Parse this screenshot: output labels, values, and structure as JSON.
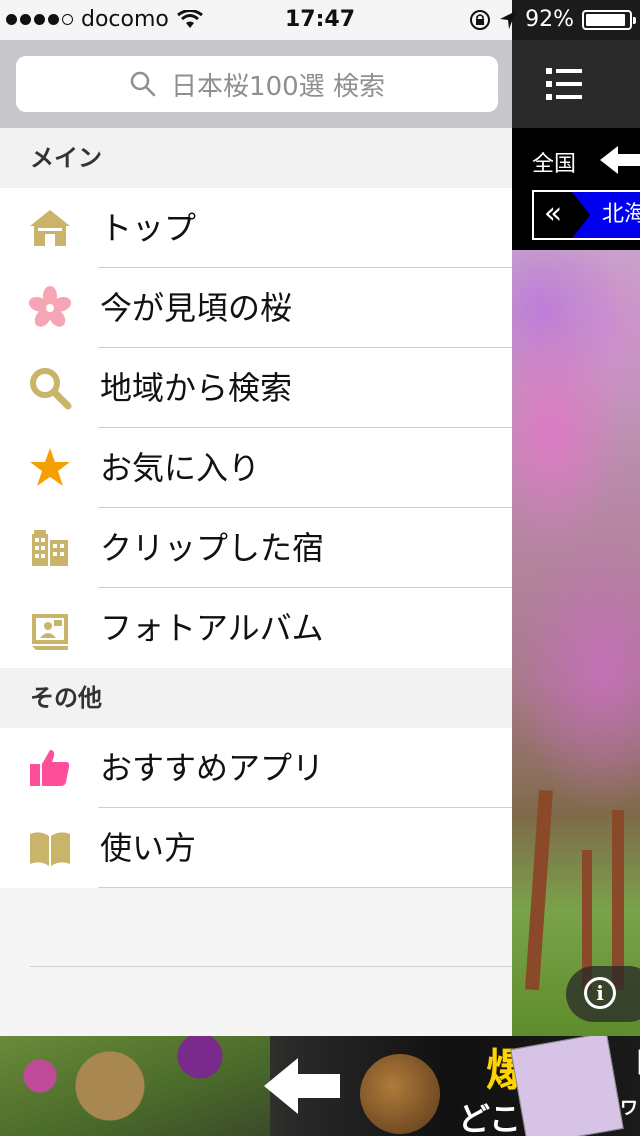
{
  "status_bar": {
    "carrier": "docomo",
    "time": "17:47",
    "battery": "92%",
    "battery_level": 0.92
  },
  "search": {
    "placeholder": "日本桜100選 検索"
  },
  "sections": [
    {
      "title": "メイン",
      "items": [
        {
          "label": "トップ",
          "icon": "home-icon"
        },
        {
          "label": "今が見頃の桜",
          "icon": "sakura-icon"
        },
        {
          "label": "地域から検索",
          "icon": "search-icon"
        },
        {
          "label": "お気に入り",
          "icon": "star-icon"
        },
        {
          "label": "クリップした宿",
          "icon": "hotel-icon"
        },
        {
          "label": "フォトアルバム",
          "icon": "photo-album-icon"
        }
      ]
    },
    {
      "title": "その他",
      "items": [
        {
          "label": "おすすめアプリ",
          "icon": "thumbs-up-icon"
        },
        {
          "label": "使い方",
          "icon": "book-icon"
        }
      ]
    }
  ],
  "main": {
    "region_label": "全国",
    "region_pill_prefix": "«",
    "region_name": "北海"
  },
  "ad": {
    "text_yellow": "爆",
    "text_white": "どこ",
    "bracket": "「",
    "text_wa": "ワ"
  },
  "colors": {
    "icon_gold": "#c9b469",
    "star_orange": "#f5a000",
    "sakura_pink": "#f4a6b4",
    "thumb_pink": "#ff4f9a",
    "region_blue": "#0000ee"
  }
}
